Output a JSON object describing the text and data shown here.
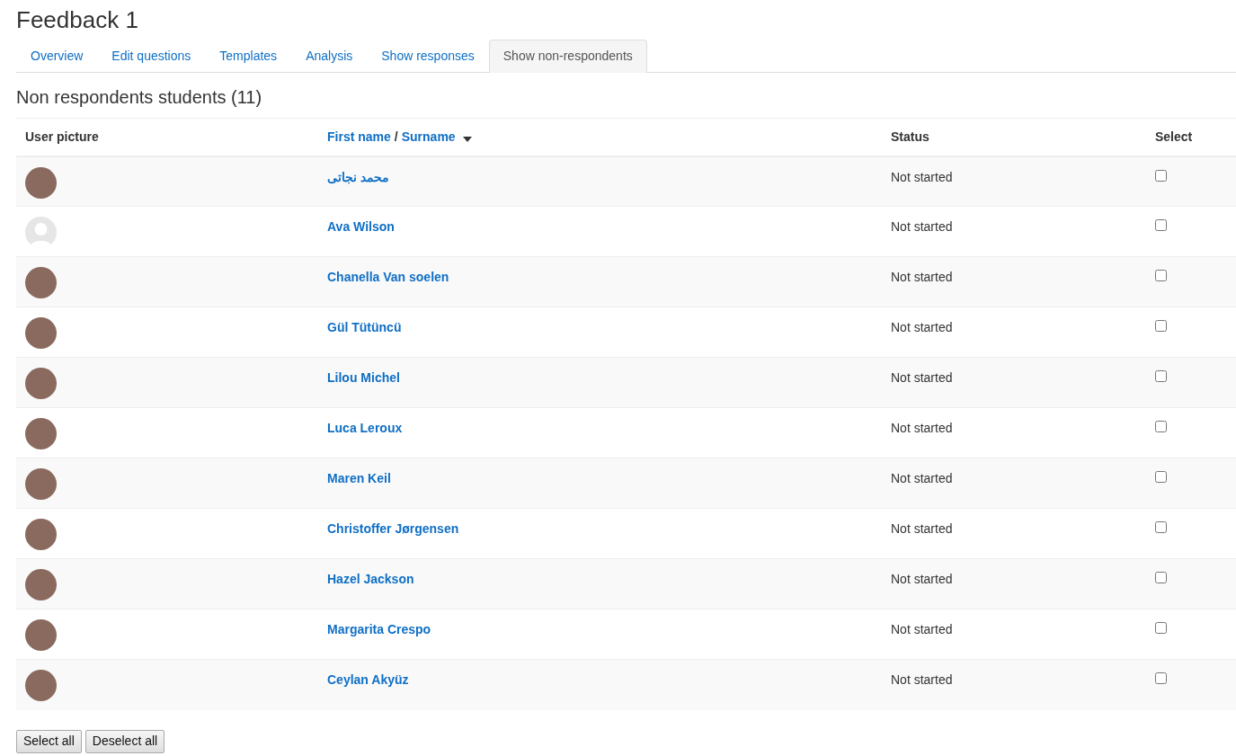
{
  "page": {
    "title": "Feedback 1"
  },
  "tabs": [
    {
      "label": "Overview",
      "selected": false
    },
    {
      "label": "Edit questions",
      "selected": false
    },
    {
      "label": "Templates",
      "selected": false
    },
    {
      "label": "Analysis",
      "selected": false
    },
    {
      "label": "Show responses",
      "selected": false
    },
    {
      "label": "Show non-respondents",
      "selected": true
    }
  ],
  "section_title": "Non respondents students (11)",
  "table": {
    "columns": [
      {
        "kind": "text",
        "label": "User picture"
      },
      {
        "kind": "sort",
        "links": [
          "First name",
          "Surname"
        ],
        "separator": "/"
      },
      {
        "kind": "text",
        "label": "Status"
      },
      {
        "kind": "text",
        "label": "Select"
      }
    ],
    "rows": [
      {
        "kind": "photo",
        "name": "محمد نجاتی",
        "status": "Not started",
        "checked": false
      },
      {
        "kind": "default",
        "name": "Ava Wilson",
        "status": "Not started",
        "checked": false
      },
      {
        "kind": "photo",
        "name": "Chanella Van soelen",
        "status": "Not started",
        "checked": false
      },
      {
        "kind": "photo",
        "name": "Gül Tütüncü",
        "status": "Not started",
        "checked": false
      },
      {
        "kind": "photo",
        "name": "Lilou Michel",
        "status": "Not started",
        "checked": false
      },
      {
        "kind": "photo",
        "name": "Luca Leroux",
        "status": "Not started",
        "checked": false
      },
      {
        "kind": "photo",
        "name": "Maren Keil",
        "status": "Not started",
        "checked": false
      },
      {
        "kind": "photo",
        "name": "Christoffer Jørgensen",
        "status": "Not started",
        "checked": false
      },
      {
        "kind": "photo",
        "name": "Hazel Jackson",
        "status": "Not started",
        "checked": false
      },
      {
        "kind": "photo",
        "name": "Margarita Crespo",
        "status": "Not started",
        "checked": false
      },
      {
        "kind": "photo",
        "name": "Ceylan Akyüz",
        "status": "Not started",
        "checked": false
      }
    ]
  },
  "buttons": [
    "Select all",
    "Deselect all"
  ]
}
